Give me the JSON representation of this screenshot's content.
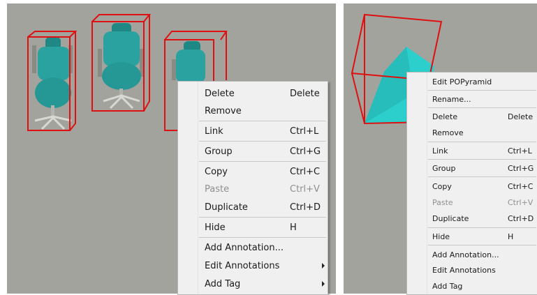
{
  "menu_left": {
    "items": [
      {
        "label": "Delete",
        "shortcut": "Delete"
      },
      {
        "label": "Remove",
        "shortcut": ""
      },
      {
        "label": "Link",
        "shortcut": "Ctrl+L"
      },
      {
        "label": "Group",
        "shortcut": "Ctrl+G"
      },
      {
        "label": "Copy",
        "shortcut": "Ctrl+C"
      },
      {
        "label": "Paste",
        "shortcut": "Ctrl+V"
      },
      {
        "label": "Duplicate",
        "shortcut": "Ctrl+D"
      },
      {
        "label": "Hide",
        "shortcut": "H"
      },
      {
        "label": "Add Annotation...",
        "shortcut": ""
      },
      {
        "label": "Edit Annotations",
        "shortcut": ""
      },
      {
        "label": "Add Tag",
        "shortcut": ""
      }
    ]
  },
  "menu_right": {
    "items": [
      {
        "label": "Edit POPyramid",
        "shortcut": ""
      },
      {
        "label": "Rename...",
        "shortcut": ""
      },
      {
        "label": "Delete",
        "shortcut": "Delete"
      },
      {
        "label": "Remove",
        "shortcut": ""
      },
      {
        "label": "Link",
        "shortcut": "Ctrl+L"
      },
      {
        "label": "Group",
        "shortcut": "Ctrl+G"
      },
      {
        "label": "Copy",
        "shortcut": "Ctrl+C"
      },
      {
        "label": "Paste",
        "shortcut": "Ctrl+V"
      },
      {
        "label": "Duplicate",
        "shortcut": "Ctrl+D"
      },
      {
        "label": "Hide",
        "shortcut": "H"
      },
      {
        "label": "Add Annotation...",
        "shortcut": ""
      },
      {
        "label": "Edit Annotations",
        "shortcut": ""
      },
      {
        "label": "Add Tag",
        "shortcut": ""
      }
    ]
  },
  "colors": {
    "viewport_bg": "#a3a39d",
    "selection_box": "#dd1111",
    "chair_teal": "#2aa3a0",
    "pyramid_teal": "#2ccfcc",
    "menu_bg": "#f0f0f0",
    "disabled_text": "#8f8f8f"
  }
}
